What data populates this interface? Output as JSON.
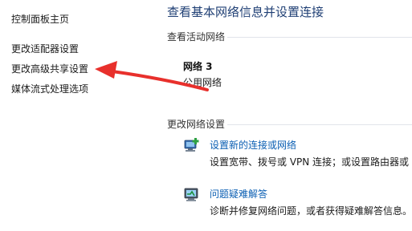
{
  "sidebar": {
    "items": [
      {
        "label": "控制面板主页"
      },
      {
        "label": "更改适配器设置"
      },
      {
        "label": "更改高级共享设置"
      },
      {
        "label": "媒体流式处理选项"
      }
    ]
  },
  "main": {
    "title": "查看基本网络信息并设置连接",
    "active_networks": {
      "heading": "查看活动网络",
      "network_name": "网络 3",
      "network_type": "公用网络"
    },
    "change_settings": {
      "heading": "更改网络设置",
      "items": [
        {
          "icon": "new-connection-icon",
          "title": "设置新的连接或网络",
          "description": "设置宽带、拨号或 VPN 连接；或设置路由器或"
        },
        {
          "icon": "troubleshoot-icon",
          "title": "问题疑难解答",
          "description": "诊断并修复网络问题，或者获得疑难解答信息。"
        }
      ]
    }
  },
  "annotation": {
    "arrow_color": "#e8302c"
  },
  "colors": {
    "link": "#0b5fb3",
    "title": "#1f3f74"
  }
}
